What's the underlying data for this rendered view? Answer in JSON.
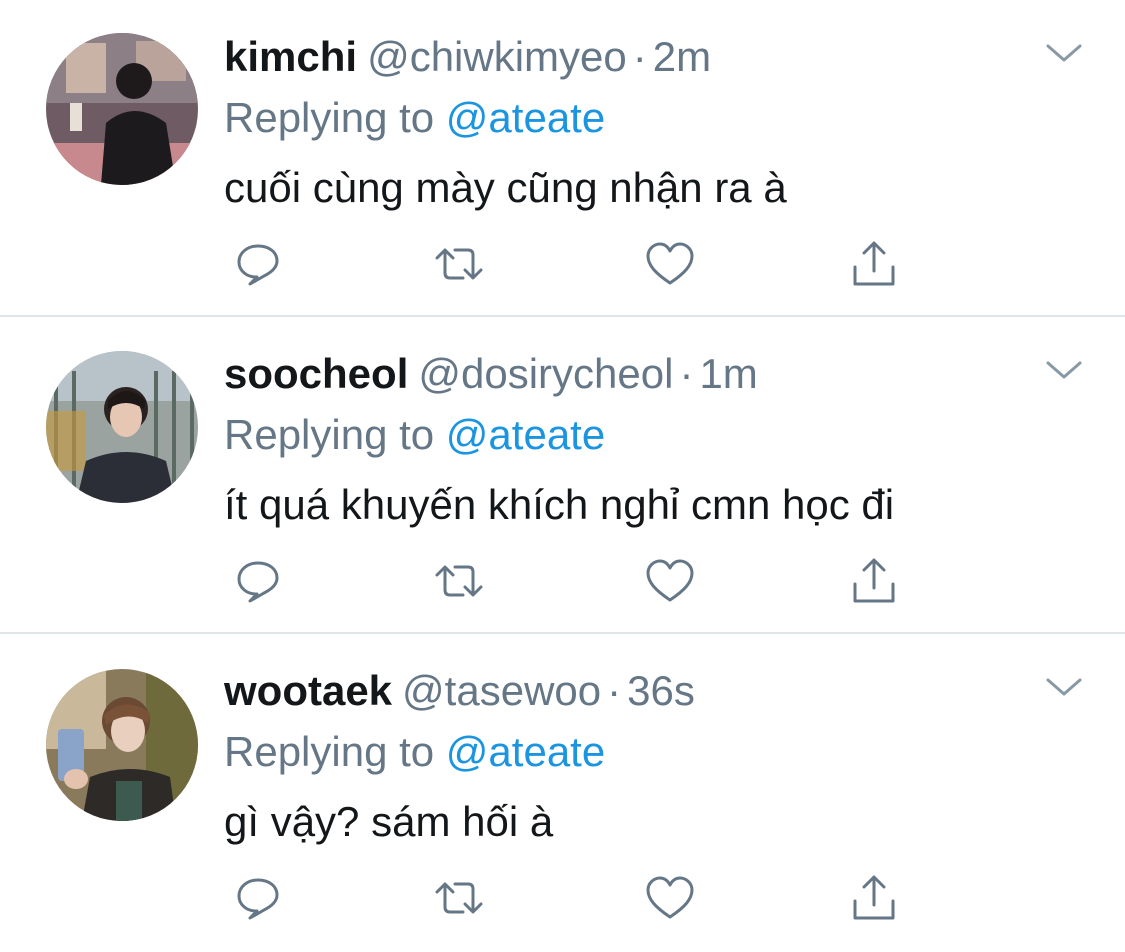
{
  "tweets": [
    {
      "display_name": "kimchi",
      "handle": "@chiwkimyeo",
      "separator": "·",
      "time": "2m",
      "replying_prefix": "Replying to",
      "replying_to": "@ateate",
      "text": "cuối cùng mày cũng nhận ra à"
    },
    {
      "display_name": "soocheol",
      "handle": "@dosirycheol",
      "separator": "·",
      "time": "1m",
      "replying_prefix": "Replying to",
      "replying_to": "@ateate",
      "text": "ít quá khuyến khích nghỉ cmn học đi"
    },
    {
      "display_name": "wootaek",
      "handle": "@tasewoo",
      "separator": "·",
      "time": "36s",
      "replying_prefix": "Replying to",
      "replying_to": "@ateate",
      "text": "gì vậy? sám hối à"
    }
  ],
  "icons": {
    "caret": "chevron-down-icon",
    "reply": "reply-icon",
    "retweet": "retweet-icon",
    "like": "heart-icon",
    "share": "share-icon"
  },
  "colors": {
    "text_primary": "#14171a",
    "text_secondary": "#657786",
    "link": "#1b95e0",
    "divider": "#e1e5e9"
  }
}
